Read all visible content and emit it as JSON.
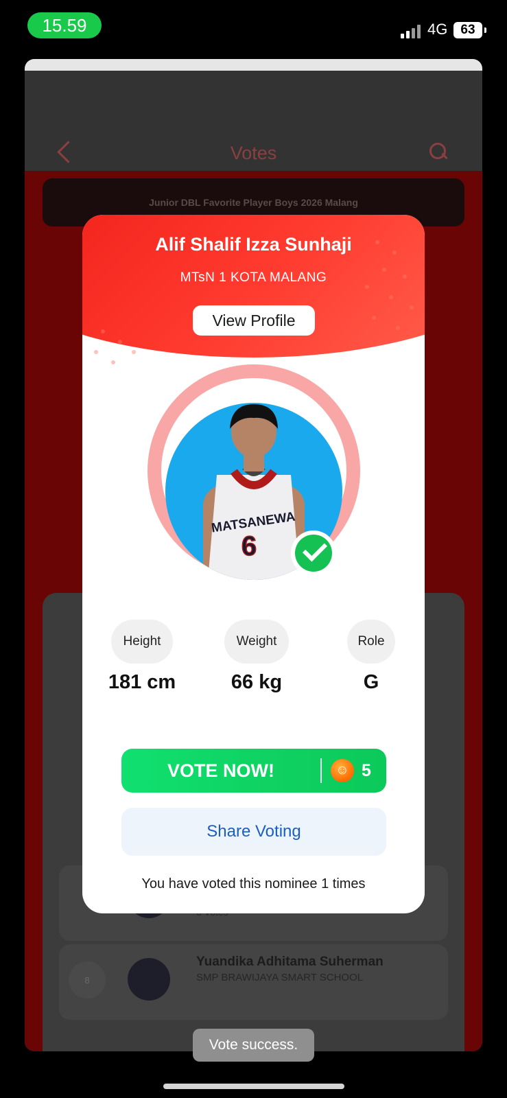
{
  "status_bar": {
    "time": "15.59",
    "network": "4G",
    "battery": "63"
  },
  "background": {
    "header_title": "Votes",
    "banner": "Junior DBL Favorite Player Boys 2026 Malang",
    "list": [
      {
        "votes": "6 Votes"
      },
      {
        "rank": "8",
        "name": "Yuandika Adhitama Suherman",
        "school": "SMP BRAWIJAYA SMART SCHOOL"
      }
    ]
  },
  "modal": {
    "player_name": "Alif Shalif Izza Sunhaji",
    "school": "MTsN 1 KOTA MALANG",
    "view_profile_label": "View Profile",
    "jersey_text": "MATSANEWA",
    "jersey_number": "6",
    "stats": [
      {
        "label": "Height",
        "value": "181 cm"
      },
      {
        "label": "Weight",
        "value": "66 kg"
      },
      {
        "label": "Role",
        "value": "G"
      }
    ],
    "vote_label": "VOTE NOW!",
    "vote_cost": "5",
    "share_label": "Share Voting",
    "voted_message": "You have voted this nominee 1 times"
  },
  "toast": "Vote success."
}
